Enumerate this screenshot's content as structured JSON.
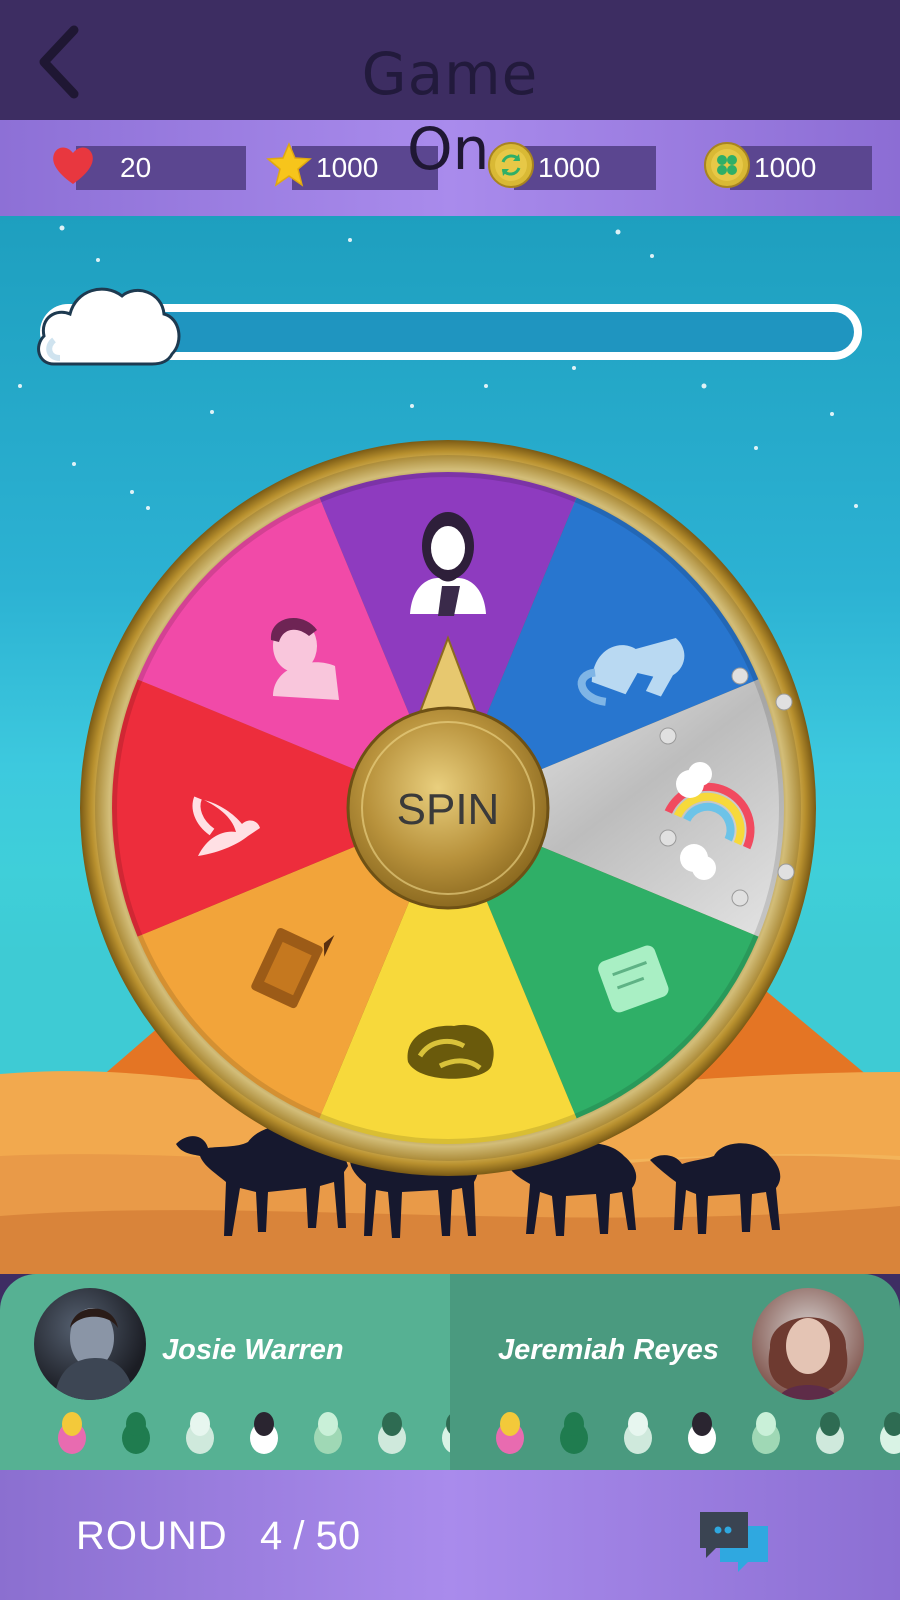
{
  "header": {
    "title": "Game",
    "title_overflow": "On",
    "back_icon": "chevron-left-icon"
  },
  "stats": {
    "lives": {
      "icon": "heart-icon",
      "value": "20",
      "color": "#e8373f"
    },
    "stars": {
      "icon": "star-icon",
      "value": "1000",
      "color": "#f7c51b"
    },
    "refresh_coins": {
      "icon": "refresh-coin-icon",
      "value": "1000",
      "color": "#d9b935"
    },
    "clover_coins": {
      "icon": "clover-coin-icon",
      "value": "1000",
      "color": "#d9b935"
    }
  },
  "progress": {
    "fraction": 0.0,
    "icon": "cloud-icon"
  },
  "wheel": {
    "spin_label": "SPIN",
    "segments": [
      {
        "name": "jesus",
        "color": "#8e3bbf",
        "icon": "jesus-icon"
      },
      {
        "name": "elephant",
        "color": "#2876cf",
        "icon": "elephant-icon"
      },
      {
        "name": "rainbow",
        "color": "#c9c9c9",
        "icon": "rainbow-icon"
      },
      {
        "name": "scroll",
        "color": "#2faf67",
        "icon": "scroll-icon"
      },
      {
        "name": "manna",
        "color": "#f7d93b",
        "icon": "manna-icon"
      },
      {
        "name": "bible",
        "color": "#f2a43a",
        "icon": "bible-icon"
      },
      {
        "name": "angel",
        "color": "#ed2d3c",
        "icon": "angel-icon"
      },
      {
        "name": "man",
        "color": "#f14aa8",
        "icon": "man-icon"
      }
    ]
  },
  "players": [
    {
      "name": "Josie Warren",
      "tokens": [
        "king-icon",
        "book-icon",
        "angel-icon",
        "jesus-icon",
        "scroll-icon",
        "manna-icon",
        "man-icon"
      ]
    },
    {
      "name": "Jeremiah Reyes",
      "tokens": [
        "king-icon",
        "book-icon",
        "angel-icon",
        "jesus-icon",
        "scroll-icon",
        "manna-icon",
        "man-icon"
      ]
    }
  ],
  "footer": {
    "round_label": "ROUND",
    "round_value": "4 / 50",
    "chat_icon": "chat-icon"
  },
  "colors": {
    "header_bg": "#3d2d62",
    "bar_purple": "#a98bec",
    "player_left": "#56b193",
    "player_right": "#4a9a7f",
    "gold": "#c9a74a"
  }
}
